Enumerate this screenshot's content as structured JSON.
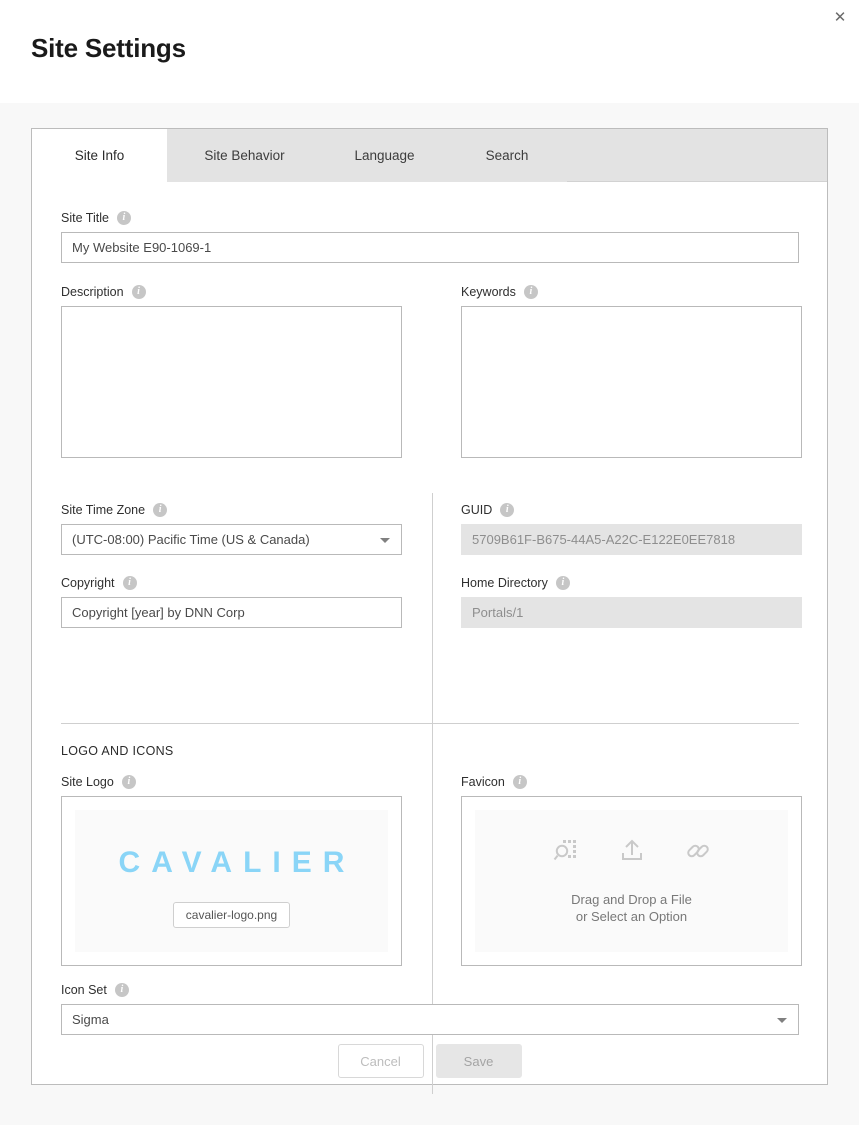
{
  "header": {
    "title": "Site Settings",
    "close_label": "✕"
  },
  "tabs": [
    {
      "label": "Site Info",
      "active": true
    },
    {
      "label": "Site Behavior",
      "active": false
    },
    {
      "label": "Language",
      "active": false
    },
    {
      "label": "Search",
      "active": false
    }
  ],
  "info_glyph": "i",
  "fields": {
    "site_title": {
      "label": "Site Title",
      "value": "My Website E90-1069-1",
      "placeholder": ""
    },
    "description": {
      "label": "Description",
      "value": "",
      "placeholder": ""
    },
    "keywords": {
      "label": "Keywords",
      "value": "",
      "placeholder": ""
    },
    "site_time_zone": {
      "label": "Site Time Zone",
      "value": "(UTC-08:00) Pacific Time (US & Canada)"
    },
    "guid": {
      "label": "GUID",
      "value": "5709B61F-B675-44A5-A22C-E122E0EE7818"
    },
    "copyright": {
      "label": "Copyright",
      "value": "Copyright [year] by DNN Corp",
      "placeholder": ""
    },
    "home_directory": {
      "label": "Home Directory",
      "value": "Portals/1"
    },
    "site_logo": {
      "label": "Site Logo",
      "logo_text": "CAVALIER",
      "file_name": "cavalier-logo.png"
    },
    "favicon": {
      "label": "Favicon",
      "dropzone_line1": "Drag and Drop a File",
      "dropzone_line2": "or Select an Option",
      "icons": [
        "browse-file-icon",
        "upload-icon",
        "link-icon"
      ]
    },
    "icon_set": {
      "label": "Icon Set",
      "value": "Sigma"
    }
  },
  "section": {
    "logo_and_icons": "LOGO AND ICONS"
  },
  "actions": {
    "cancel_label": "Cancel",
    "save_label": "Save"
  },
  "colors": {
    "logo_blue": "#8ad5f7",
    "page_background": "#f8f8f8",
    "tab_inactive": "#e3e3e3"
  }
}
